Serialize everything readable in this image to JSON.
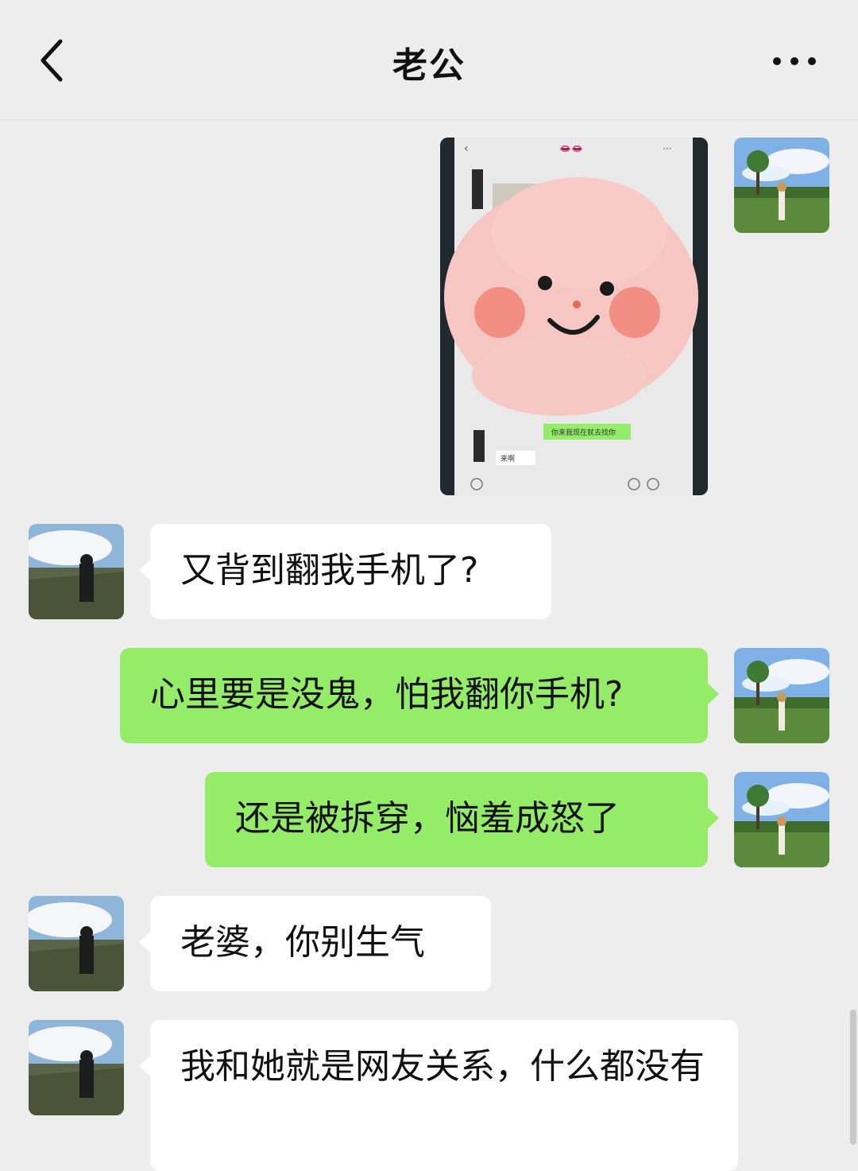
{
  "header": {
    "title": "老公",
    "back_icon": "chevron-left-icon",
    "more_icon": "more-dots-icon"
  },
  "photo": {
    "caption": "screenshot of chat with sticker overlay",
    "screen_texts": [
      "你来我现在就去找你",
      "来啊"
    ]
  },
  "messages": [
    {
      "side": "left",
      "text": "又背到翻我手机了?"
    },
    {
      "side": "right",
      "text": "心里要是没鬼，怕我翻你手机?"
    },
    {
      "side": "right",
      "text": "还是被拆穿，恼羞成怒了"
    },
    {
      "side": "left",
      "text": "老婆，你别生气"
    },
    {
      "side": "left",
      "text": "我和她就是网友关系，什么都没有"
    }
  ],
  "colors": {
    "background": "#ededed",
    "self_bubble": "#95ec69",
    "other_bubble": "#ffffff"
  }
}
